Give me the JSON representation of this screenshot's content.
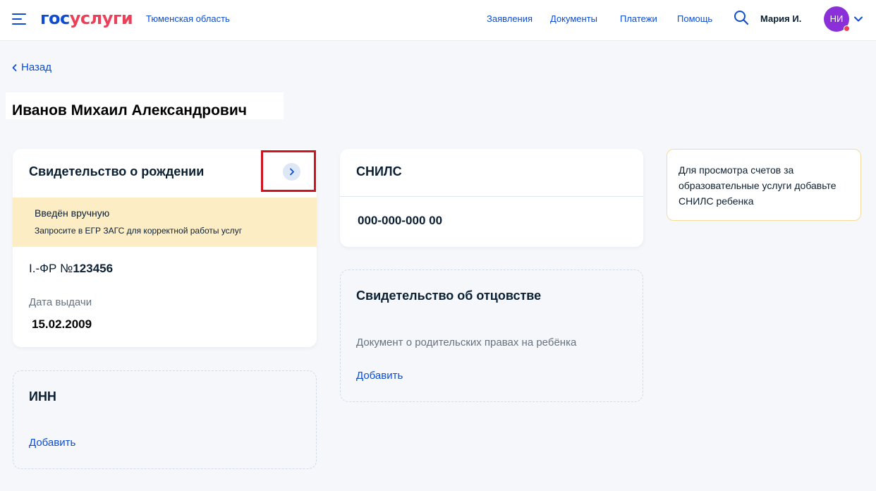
{
  "header": {
    "logo_part1": "гос",
    "logo_part2": "услуги",
    "region": "Тюменская область",
    "nav": [
      "Заявления",
      "Документы",
      "Платежи",
      "Помощь"
    ],
    "user_name": "Мария И.",
    "avatar_initials": "НИ",
    "icons": [
      "menu-icon",
      "search-icon",
      "chevron-down-icon"
    ]
  },
  "back_label": "Назад",
  "page_title": "Иванов Михаил Александрович",
  "birth_cert": {
    "title": "Свидетельство о рождении",
    "warning_title": "Введён вручную",
    "warning_text": "Запросите в ЕГР ЗАГС для корректной работы услуг",
    "series_prefix": "I.-ФР №",
    "number": "123456",
    "issue_date_label": "Дата выдачи",
    "issue_date": "15.02.2009"
  },
  "inn": {
    "title": "ИНН",
    "add_label": "Добавить"
  },
  "snils": {
    "title": "СНИЛС",
    "value": "000-000-000 00"
  },
  "paternity": {
    "title": "Свидетельство об отцовстве",
    "description": "Документ о родительских правах на ребёнка",
    "add_label": "Добавить"
  },
  "info_notice": "Для просмотра счетов за образовательные услуги добавьте СНИЛС ребенка",
  "colors": {
    "brand_blue": "#0d4cd3",
    "brand_red": "#ee3f58",
    "avatar": "#8b2fd8",
    "warning_bg": "#fdedc5",
    "notice_border": "#f6dc9c",
    "highlight": "#d0141f"
  }
}
